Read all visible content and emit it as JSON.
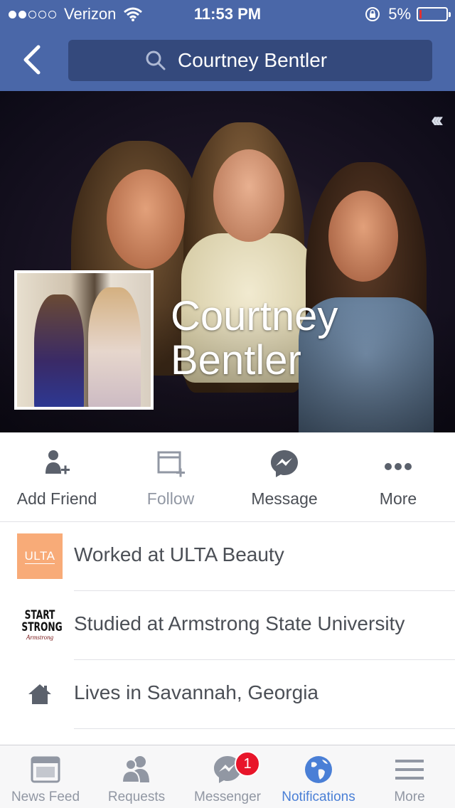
{
  "status_bar": {
    "carrier": "Verizon",
    "signal_bars_filled": 2,
    "signal_bars_total": 5,
    "time": "11:53 PM",
    "battery": "5%",
    "battery_level": 0.05,
    "icons": [
      "signal-dots-icon",
      "wifi-icon",
      "rotation-lock-icon",
      "battery-icon"
    ]
  },
  "nav": {
    "back_icon": "chevron-left-icon",
    "search_icon": "search-icon",
    "search_value": "Courtney Bentler"
  },
  "cover": {
    "collapse_icon": "triple-chevron-left-icon"
  },
  "profile": {
    "name": "Courtney Bentler"
  },
  "actions": [
    {
      "label": "Add Friend",
      "icon": "add-friend-icon"
    },
    {
      "label": "Follow",
      "icon": "follow-icon"
    },
    {
      "label": "Message",
      "icon": "messenger-icon"
    },
    {
      "label": "More",
      "icon": "more-dots-icon"
    }
  ],
  "about": [
    {
      "text": "Worked at ULTA Beauty",
      "logo_text": "ULTA"
    },
    {
      "text": "Studied at Armstrong State University",
      "logo_lines": [
        "START",
        "STRONG",
        "Armstrong"
      ]
    },
    {
      "text": "Lives in Savannah, Georgia",
      "icon": "home-icon"
    }
  ],
  "tabs": [
    {
      "label": "News Feed",
      "icon": "news-feed-icon"
    },
    {
      "label": "Requests",
      "icon": "friend-requests-icon"
    },
    {
      "label": "Messenger",
      "icon": "messenger-icon",
      "badge": "1"
    },
    {
      "label": "Notifications",
      "icon": "globe-icon",
      "active": true
    },
    {
      "label": "More",
      "icon": "hamburger-icon"
    }
  ],
  "colors": {
    "brand_blue": "#4a67a8",
    "search_field": "#34497c",
    "active_tab": "#4a7fd6",
    "badge_red": "#e8152a",
    "ulta_orange": "#f8ab78"
  }
}
